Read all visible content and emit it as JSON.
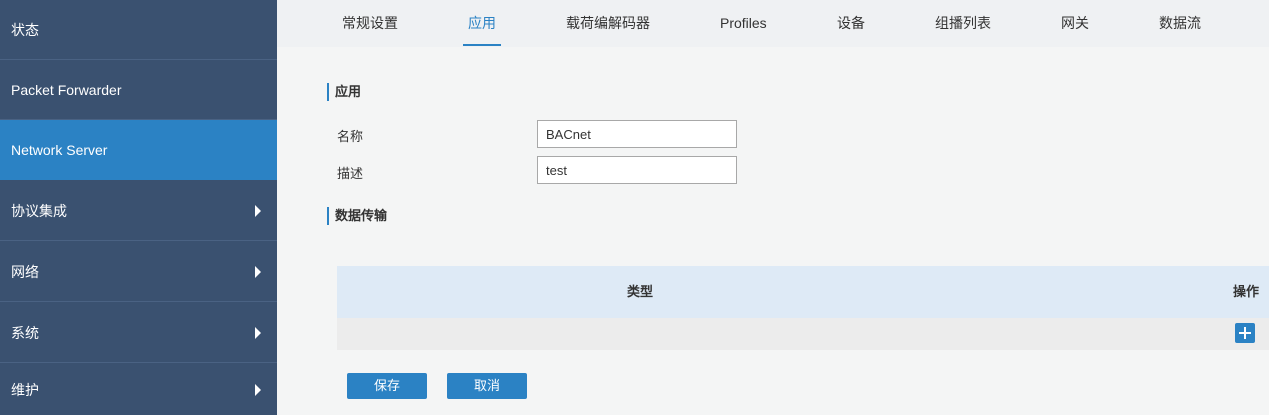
{
  "sidebar": {
    "items": [
      {
        "label": "状态"
      },
      {
        "label": "Packet Forwarder"
      },
      {
        "label": "Network Server"
      },
      {
        "label": "协议集成"
      },
      {
        "label": "网络"
      },
      {
        "label": "系统"
      },
      {
        "label": "维护"
      }
    ],
    "active_item": "Network Server"
  },
  "tabs": [
    {
      "label": "常规设置"
    },
    {
      "label": "应用"
    },
    {
      "label": "载荷编解码器"
    },
    {
      "label": "Profiles"
    },
    {
      "label": "设备"
    },
    {
      "label": "组播列表"
    },
    {
      "label": "网关"
    },
    {
      "label": "数据流"
    }
  ],
  "active_tab": "应用",
  "form": {
    "section_title": "应用",
    "name_label": "名称",
    "name_value": "BACnet",
    "description_label": "描述",
    "description_value": "test"
  },
  "data_transfer": {
    "section_title": "数据传输",
    "columns": {
      "type": "类型",
      "action": "操作"
    }
  },
  "buttons": {
    "save": "保存",
    "cancel": "取消"
  },
  "colors": {
    "accent": "#2b82c4",
    "sidebar": "#3a5170",
    "table_header": "#deeaf6"
  }
}
